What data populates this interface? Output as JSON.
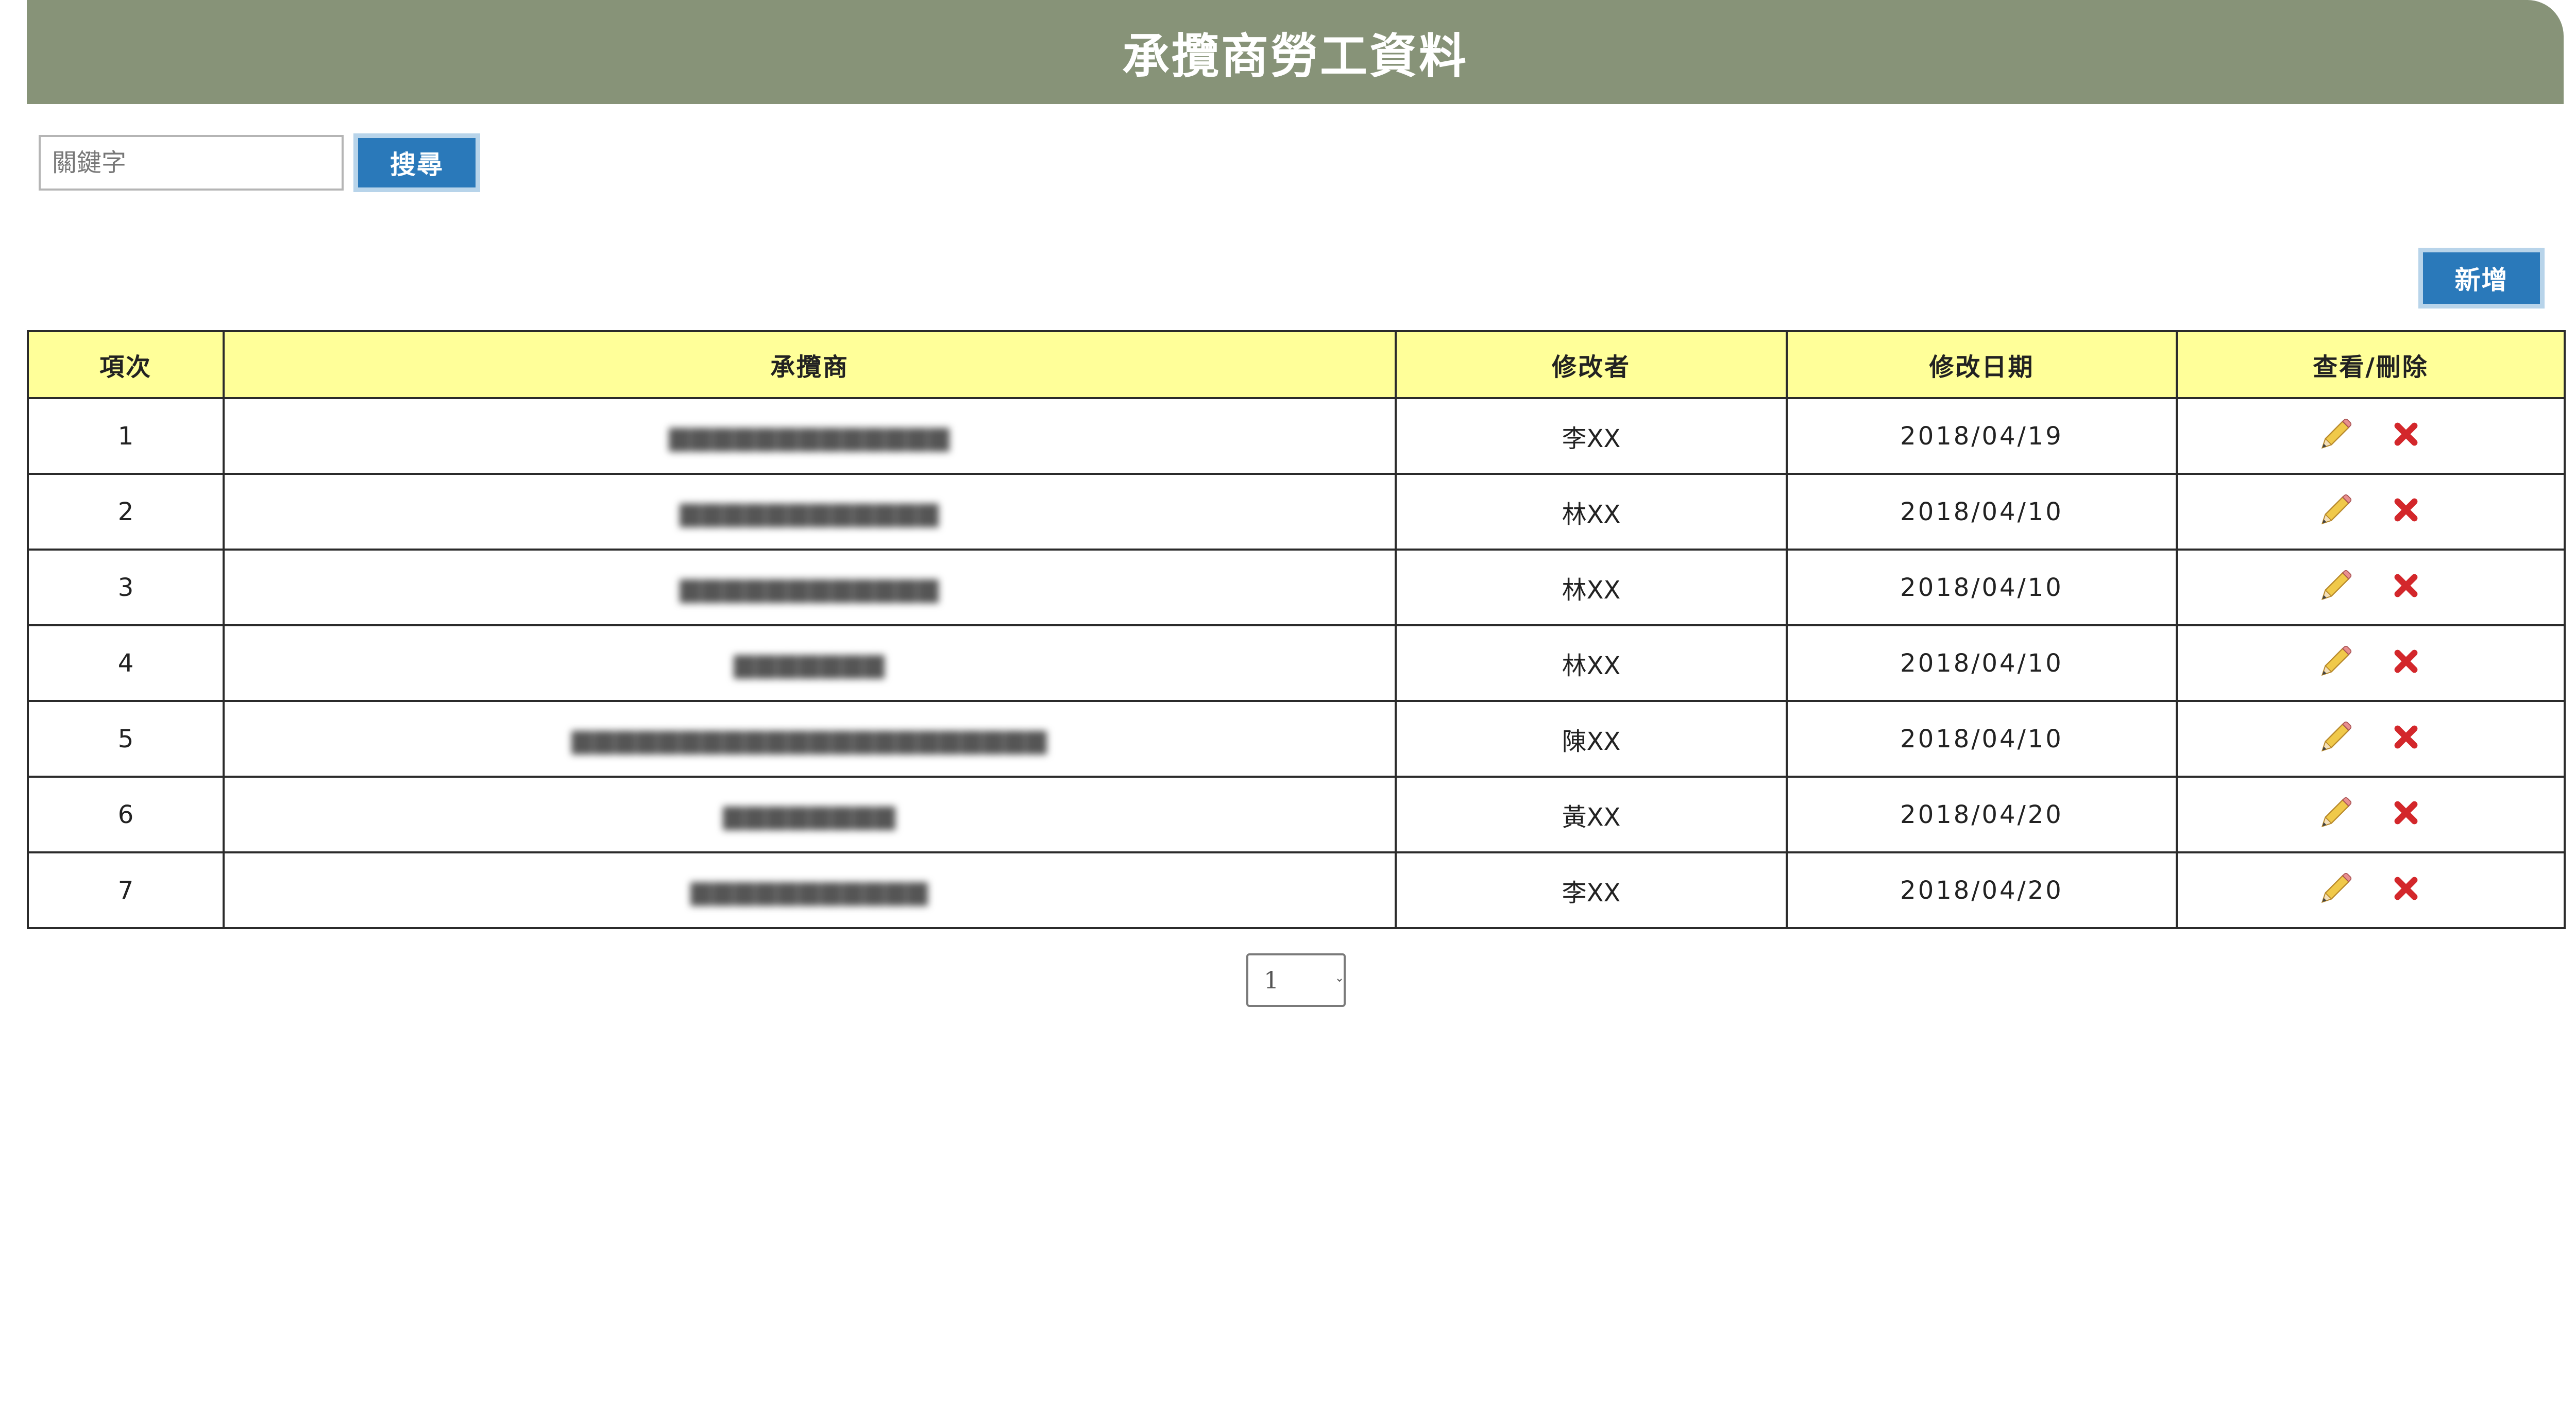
{
  "header": {
    "title": "承攬商勞工資料"
  },
  "search": {
    "placeholder": "關鍵字",
    "value": "",
    "button_label": "搜尋"
  },
  "toolbar": {
    "add_label": "新增"
  },
  "table": {
    "columns": [
      "項次",
      "承攬商",
      "修改者",
      "修改日期",
      "查看/刪除"
    ],
    "rows": [
      {
        "index": "1",
        "contractor": "▆▆▆▆▆▆▆▆▆▆▆▆▆",
        "modifier": "李XX",
        "date": "2018/04/19"
      },
      {
        "index": "2",
        "contractor": "▆▆▆▆▆▆▆▆▆▆▆▆",
        "modifier": "林XX",
        "date": "2018/04/10"
      },
      {
        "index": "3",
        "contractor": "▆▆▆▆▆▆▆▆▆▆▆▆",
        "modifier": "林XX",
        "date": "2018/04/10"
      },
      {
        "index": "4",
        "contractor": "▆▆▆▆▆▆▆",
        "modifier": "林XX",
        "date": "2018/04/10"
      },
      {
        "index": "5",
        "contractor": "▆▆▆▆▆▆▆▆▆▆▆▆▆▆▆▆▆▆▆▆▆▆",
        "modifier": "陳XX",
        "date": "2018/04/10"
      },
      {
        "index": "6",
        "contractor": "▆▆▆▆▆▆▆▆",
        "modifier": "黃XX",
        "date": "2018/04/20"
      },
      {
        "index": "7",
        "contractor": "▆▆▆▆▆▆▆▆▆▆▆",
        "modifier": "李XX",
        "date": "2018/04/20"
      }
    ],
    "row_actions": {
      "edit_icon": "pencil-icon",
      "delete_icon": "close-icon",
      "delete_color": "#d3272b"
    }
  },
  "pagination": {
    "selected": "1",
    "options": [
      "1"
    ]
  },
  "colors": {
    "header_bg": "#879378",
    "table_header_bg": "#ffff99",
    "button_bg": "#2a79ba"
  }
}
